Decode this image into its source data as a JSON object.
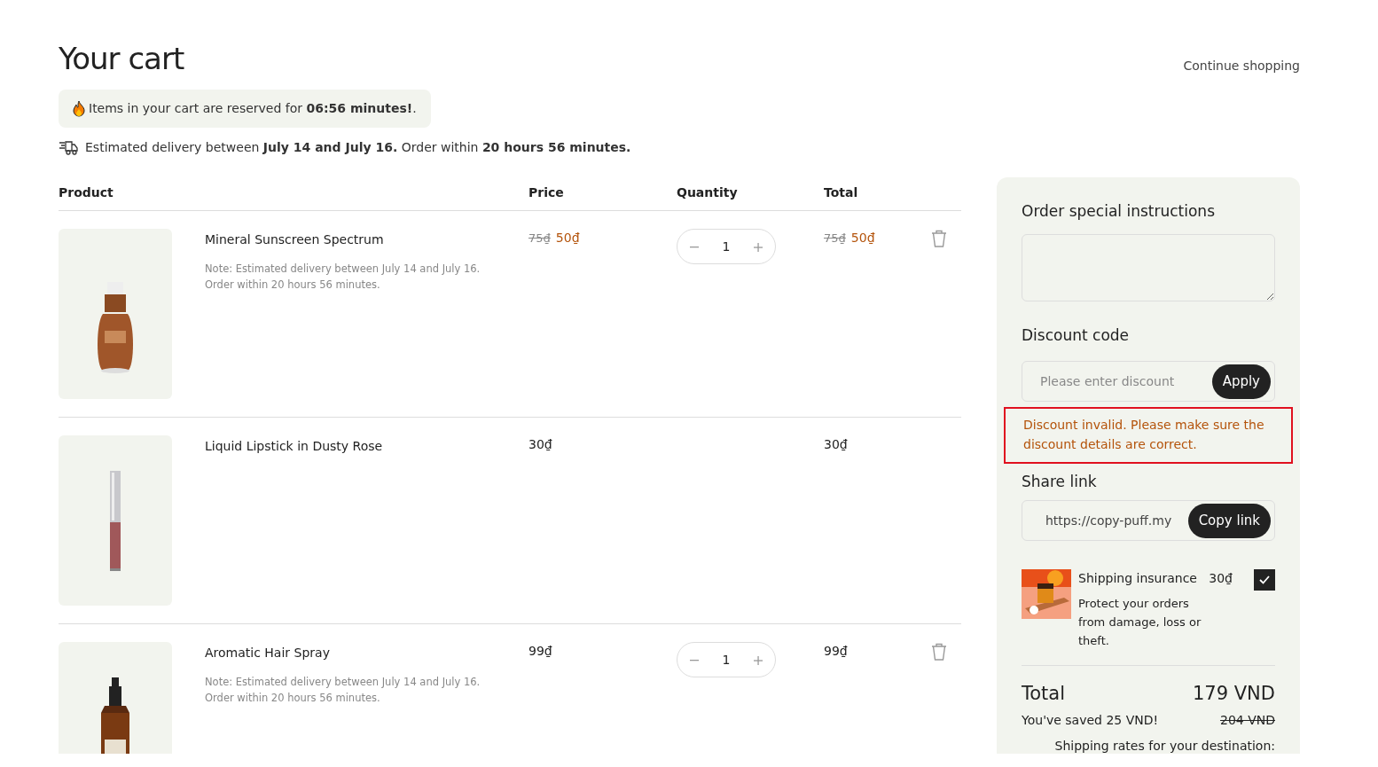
{
  "title": "Your cart",
  "continue_link": "Continue shopping",
  "reservation": "Items in your cart are reserved for **06:56 minutes!**.",
  "delivery": "Estimated delivery between **July 14 and July 16.** Order within **20 hours 56 minutes.**",
  "columns": [
    "Product",
    "Price",
    "Quantity",
    "Total"
  ],
  "items": [
    {
      "name": "Mineral Sunscreen Spectrum",
      "note": "Note: Estimated delivery between July 14 and July 16. Order within 20 hours 56 minutes.",
      "price_old": "75₫",
      "price": "50₫",
      "quantity": "1",
      "total_old": "75₫",
      "total": "50₫",
      "removable": true
    },
    {
      "name": "Liquid Lipstick in Dusty Rose",
      "price": "30₫",
      "total": "30₫",
      "removable": false
    },
    {
      "name": "Aromatic Hair Spray",
      "note": "Note: Estimated delivery between July 14 and July 16. Order within 20 hours 56 minutes.",
      "price": "99₫",
      "quantity": "1",
      "total": "99₫",
      "removable": true
    }
  ],
  "sidebar": {
    "instructions_label": "Order special instructions",
    "discount_label": "Discount code",
    "discount_placeholder": "Please enter discount",
    "apply": "Apply",
    "error": "Discount invalid. Please make sure the discount details are correct.",
    "share_label": "Share link",
    "share_value": "https://copy-puff.my",
    "copy": "Copy link",
    "insurance": {
      "title": "Shipping insurance",
      "price": "30₫",
      "description": "Protect your orders from damage, loss or theft.",
      "checked": true
    },
    "total_label": "Total",
    "total": "179 VND",
    "saved": "You've saved 25 VND!",
    "original_total": "204 VND",
    "shipping_note": "Shipping rates for your destination:"
  }
}
